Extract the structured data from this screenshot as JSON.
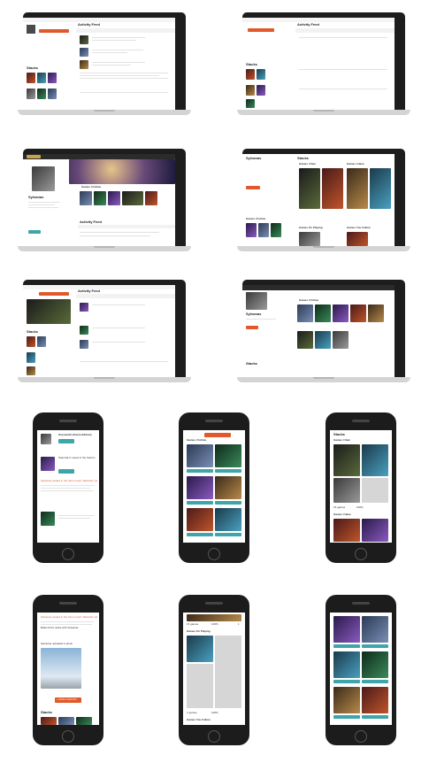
{
  "activity": {
    "title": "Activity Feed",
    "tabs": [
      "All",
      "Blogs",
      "Reviews",
      "Comments",
      "Ratings & Reviews",
      "Follows",
      "Yellow"
    ],
    "follow_label": "Follow",
    "follow_tab": "Follow",
    "time_ago": "1 day"
  },
  "profile": {
    "name": "Sylvanas",
    "stacks_label": "Stacks",
    "my_profile": "Profile",
    "follow_btn": "Follow"
  },
  "shelves": {
    "games_i_own": "Games I Own",
    "games_i_have": "Games I Have",
    "games_i_follow": "Games I Follow",
    "games_i_m_playing": "Games I'm Playing",
    "games_you_follow": "Games You Follow"
  },
  "mobile": {
    "follow_btn": "+ FOLLOW",
    "tiles": [
      {
        "title": "World of Warcraft: Legion"
      },
      {
        "title": "World of Warcraft: Legion"
      },
      {
        "title": "Heroes of the Storm"
      },
      {
        "title": "Hearthstone: Heroes of Warcraft"
      },
      {
        "title": "Diablo III"
      },
      {
        "title": "StarCraft II"
      }
    ],
    "game_count": "15 games",
    "percent": "100%",
    "status_count": "1",
    "feed_title": "Overwatch (Game Edition)",
    "feed_line": "Starcraft II: Heart of the Swarm",
    "post_link": "Sylvanas posted in the forum topic: Warcraft, Hearthstone",
    "photo_caption": "Sylvanas uploaded a photo",
    "news_line": "Bullet Point ranks with Sylvanas",
    "add_button": "+ ADD A PHOTO",
    "stacks_heading": "Stacks",
    "games_i_own": "Games I Own",
    "games_i_follow": "Games I Follow",
    "games_i_m_playing": "Games I'm Playing",
    "games_you_follow": "Games You Follow",
    "games_i_have": "Games I Have",
    "games_count_sm": "1 games",
    "tile_heroes": "Heroes of the Storm",
    "tile_heartstone": "Hearthstone: Heroes of Warcraft",
    "tile_sc2": "StarCraft II",
    "tile_legacy": "StarCraft II: Legacy of the Void",
    "tile_sims": "The Sims 4: Get to Work",
    "tile_sims2": "The Sims 4: Get Together"
  }
}
